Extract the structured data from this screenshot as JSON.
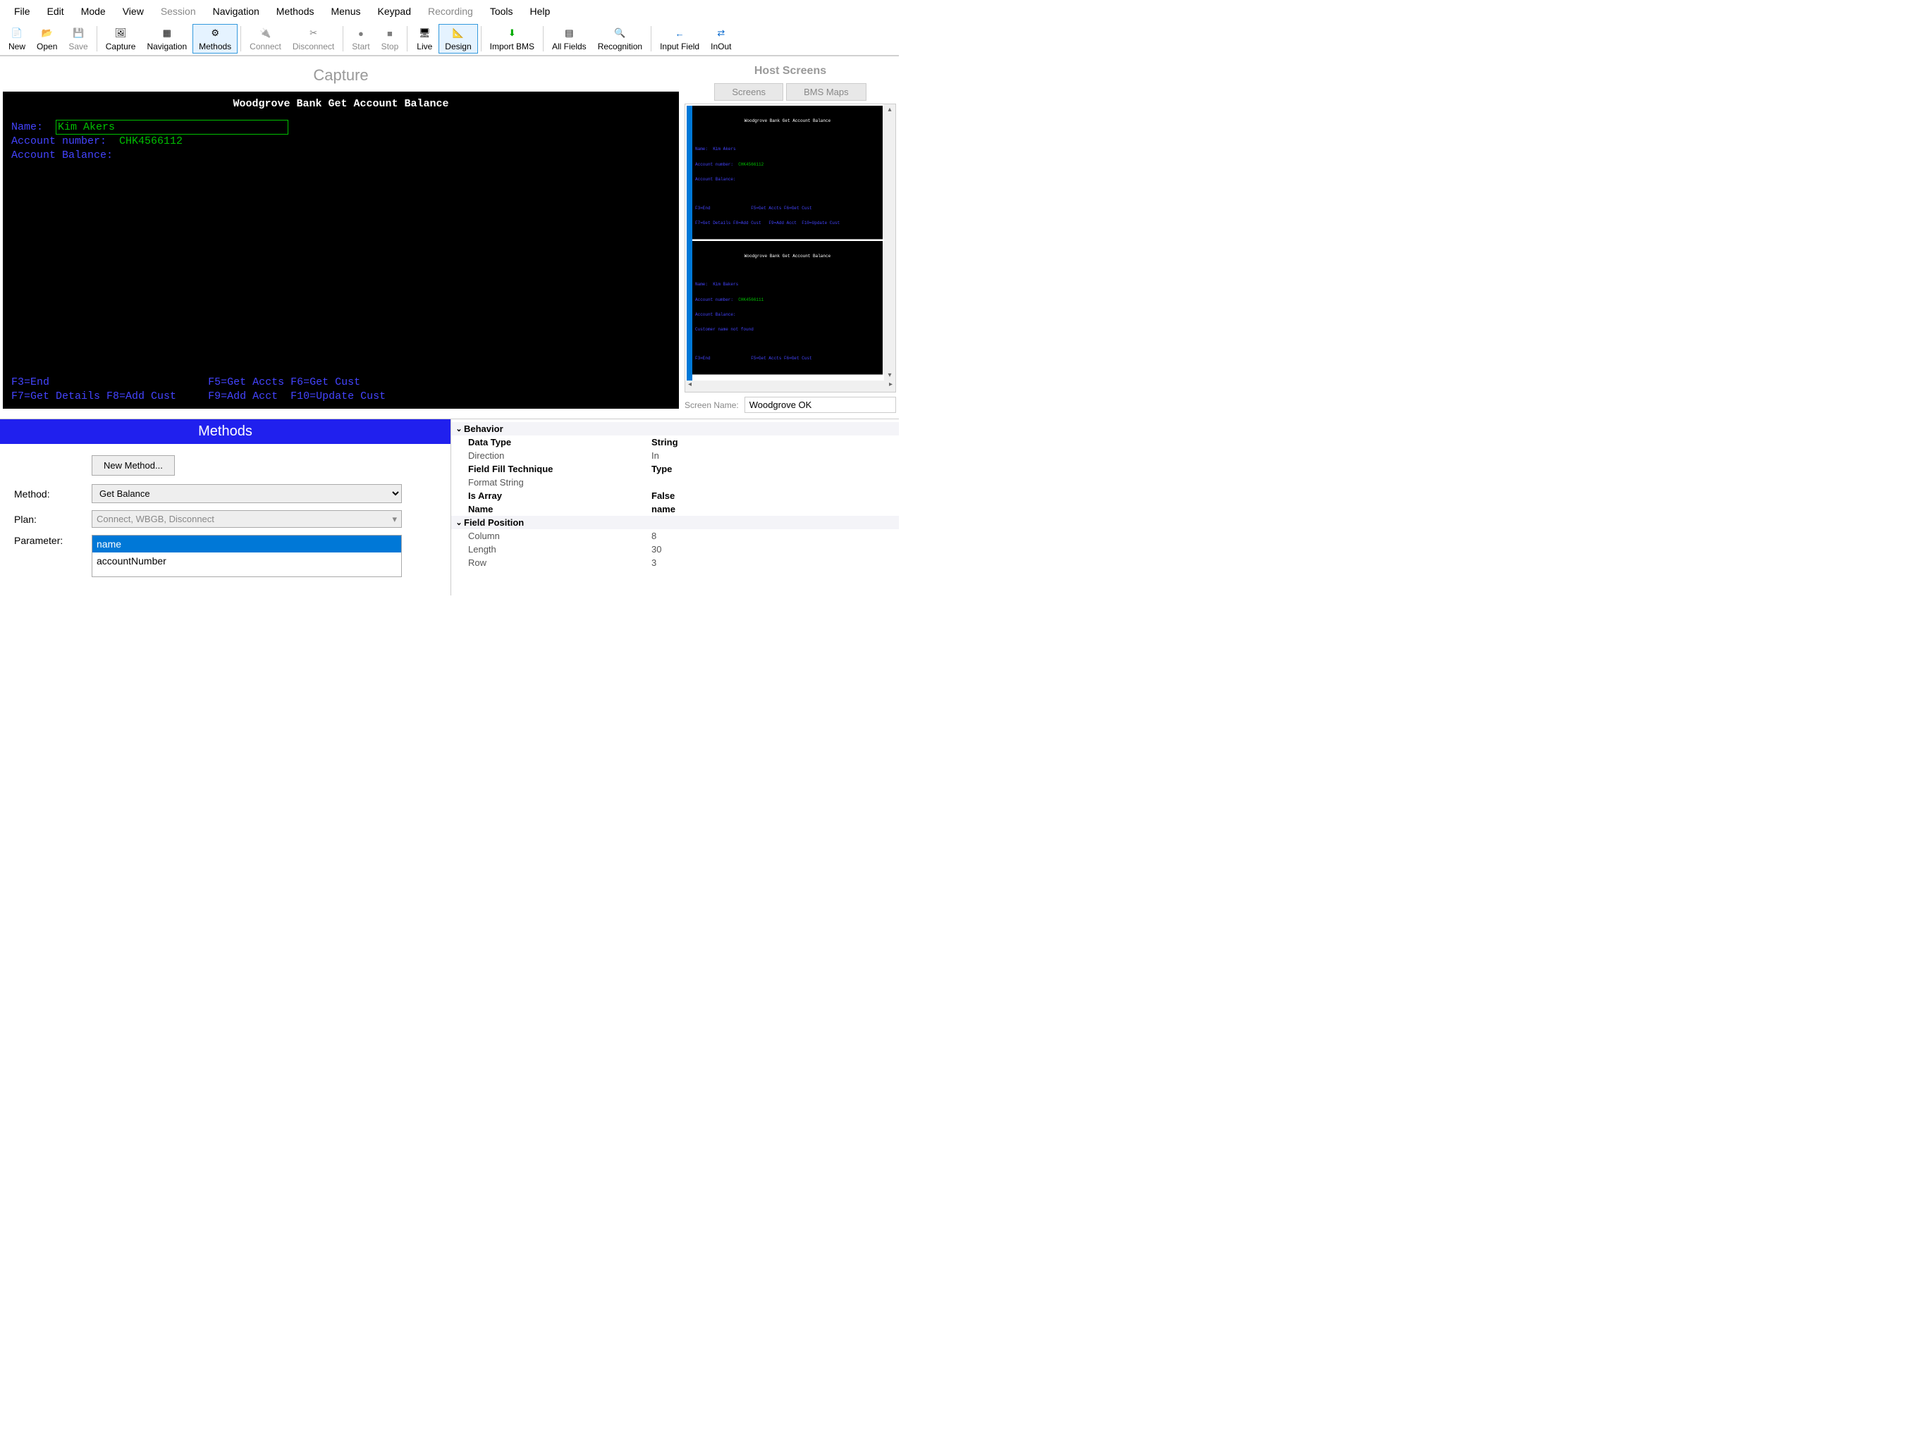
{
  "menu": {
    "items": [
      {
        "label": "File",
        "enabled": true
      },
      {
        "label": "Edit",
        "enabled": true
      },
      {
        "label": "Mode",
        "enabled": true
      },
      {
        "label": "View",
        "enabled": true
      },
      {
        "label": "Session",
        "enabled": false
      },
      {
        "label": "Navigation",
        "enabled": true
      },
      {
        "label": "Methods",
        "enabled": true
      },
      {
        "label": "Menus",
        "enabled": true
      },
      {
        "label": "Keypad",
        "enabled": true
      },
      {
        "label": "Recording",
        "enabled": false
      },
      {
        "label": "Tools",
        "enabled": true
      },
      {
        "label": "Help",
        "enabled": true
      }
    ]
  },
  "toolbar": {
    "buttons": [
      {
        "name": "new",
        "label": "New",
        "enabled": true
      },
      {
        "name": "open",
        "label": "Open",
        "enabled": true
      },
      {
        "name": "save",
        "label": "Save",
        "enabled": false
      },
      {
        "sep": true
      },
      {
        "name": "capture",
        "label": "Capture",
        "enabled": true
      },
      {
        "name": "navigation",
        "label": "Navigation",
        "enabled": true
      },
      {
        "name": "methods",
        "label": "Methods",
        "enabled": true,
        "selected": true
      },
      {
        "sep": true
      },
      {
        "name": "connect",
        "label": "Connect",
        "enabled": false
      },
      {
        "name": "disconnect",
        "label": "Disconnect",
        "enabled": false
      },
      {
        "sep": true
      },
      {
        "name": "start",
        "label": "Start",
        "enabled": false
      },
      {
        "name": "stop",
        "label": "Stop",
        "enabled": false
      },
      {
        "sep": true
      },
      {
        "name": "live",
        "label": "Live",
        "enabled": true
      },
      {
        "name": "design",
        "label": "Design",
        "enabled": true,
        "selected": true
      },
      {
        "sep": true
      },
      {
        "name": "import-bms",
        "label": "Import BMS",
        "enabled": true
      },
      {
        "sep": true
      },
      {
        "name": "all-fields",
        "label": "All Fields",
        "enabled": true
      },
      {
        "name": "recognition",
        "label": "Recognition",
        "enabled": true
      },
      {
        "sep": true
      },
      {
        "name": "input-field",
        "label": "Input Field",
        "enabled": true
      },
      {
        "name": "inout",
        "label": "InOut",
        "enabled": true
      }
    ]
  },
  "capture": {
    "panel_title": "Capture",
    "screen_title": "Woodgrove Bank Get Account Balance",
    "name_label": "Name:",
    "name_value": "Kim Akers",
    "account_number_label": "Account number:",
    "account_number_value": "CHK4566112",
    "account_balance_label": "Account Balance:",
    "footer_line1_left": "F3=End",
    "footer_line1_mid": "F5=Get Accts F6=Get Cust",
    "footer_line2_left": "F7=Get Details F8=Add Cust",
    "footer_line2_mid": "F9=Add Acct  F10=Update Cust"
  },
  "host": {
    "panel_title": "Host Screens",
    "tabs": [
      {
        "label": "Screens"
      },
      {
        "label": "BMS Maps"
      }
    ],
    "screen_name_label": "Screen Name:",
    "screen_name_value": "Woodgrove OK",
    "thumb1": {
      "title": "Woodgrove Bank Get Account Balance",
      "line1": "Name:  Kim Akers",
      "line2": "Account number:  CHK4566112",
      "line3": "Account Balance:",
      "footer1": "F3=End                F5=Get Accts F6=Get Cust",
      "footer2": "F7=Get Details F8=Add Cust   F9=Add Acct  F10=Update Cust"
    },
    "thumb2": {
      "title": "Woodgrove Bank Get Account Balance",
      "line1": "Name:  Kim Bakers",
      "line2": "Account number:  CHK4566111",
      "line3": "Account Balance:",
      "msg": "Customer name not found",
      "footer1": "F3=End                F5=Get Accts F6=Get Cust"
    }
  },
  "methods": {
    "panel_title": "Methods",
    "new_method_label": "New Method...",
    "method_label": "Method:",
    "method_value": "Get Balance",
    "plan_label": "Plan:",
    "plan_value": "Connect, WBGB, Disconnect",
    "parameter_label": "Parameter:",
    "parameters": [
      {
        "name": "name",
        "selected": true
      },
      {
        "name": "accountNumber",
        "selected": false
      }
    ]
  },
  "props": {
    "sections": [
      {
        "title": "Behavior",
        "rows": [
          {
            "name": "Data Type",
            "value": "String",
            "bold": true
          },
          {
            "name": "Direction",
            "value": "In",
            "gray": true
          },
          {
            "name": "Field Fill Technique",
            "value": "Type",
            "bold": true
          },
          {
            "name": "Format String",
            "value": "",
            "gray": true
          },
          {
            "name": "Is Array",
            "value": "False",
            "bold": true
          },
          {
            "name": "Name",
            "value": "name",
            "bold": true
          }
        ]
      },
      {
        "title": "Field Position",
        "rows": [
          {
            "name": "Column",
            "value": "8",
            "gray": true
          },
          {
            "name": "Length",
            "value": "30",
            "gray": true
          },
          {
            "name": "Row",
            "value": "3",
            "gray": true
          }
        ]
      }
    ]
  }
}
